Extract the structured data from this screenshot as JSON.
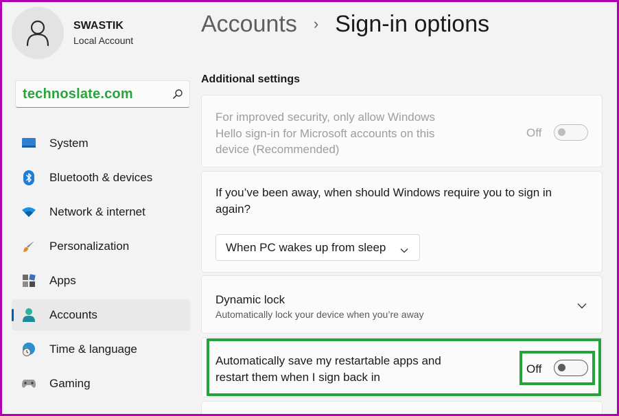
{
  "profile": {
    "name": "SWASTIK",
    "account_type": "Local Account",
    "avatar_icon": "person-icon"
  },
  "search": {
    "value": "technoslate.com",
    "icon": "search-icon"
  },
  "sidebar": {
    "items": [
      {
        "label": "System",
        "icon": "monitor-icon",
        "active": false
      },
      {
        "label": "Bluetooth & devices",
        "icon": "bluetooth-icon",
        "active": false
      },
      {
        "label": "Network & internet",
        "icon": "wifi-icon",
        "active": false
      },
      {
        "label": "Personalization",
        "icon": "brush-icon",
        "active": false
      },
      {
        "label": "Apps",
        "icon": "apps-icon",
        "active": false
      },
      {
        "label": "Accounts",
        "icon": "accounts-icon",
        "active": true
      },
      {
        "label": "Time & language",
        "icon": "globe-clock-icon",
        "active": false
      },
      {
        "label": "Gaming",
        "icon": "gamepad-icon",
        "active": false
      }
    ]
  },
  "breadcrumb": {
    "parent": "Accounts",
    "separator": "›",
    "current": "Sign-in options"
  },
  "section": {
    "title": "Additional settings"
  },
  "settings": {
    "windows_hello_only": {
      "text": "For improved security, only allow Windows Hello sign-in for Microsoft accounts on this device (Recommended)",
      "state_label": "Off",
      "on": false,
      "disabled": true
    },
    "require_sign_in": {
      "text": "If you’ve been away, when should Windows require you to sign in again?",
      "dropdown_value": "When PC wakes up from sleep"
    },
    "dynamic_lock": {
      "title": "Dynamic lock",
      "subtitle": "Automatically lock your device when you’re away"
    },
    "restart_apps": {
      "text": "Automatically save my restartable apps and restart them when I sign back in",
      "state_label": "Off",
      "on": false
    }
  },
  "colors": {
    "accent": "#005fb8",
    "highlight": "#22a33c",
    "frame": "#b100b1",
    "watermark": "#2aa33c"
  }
}
